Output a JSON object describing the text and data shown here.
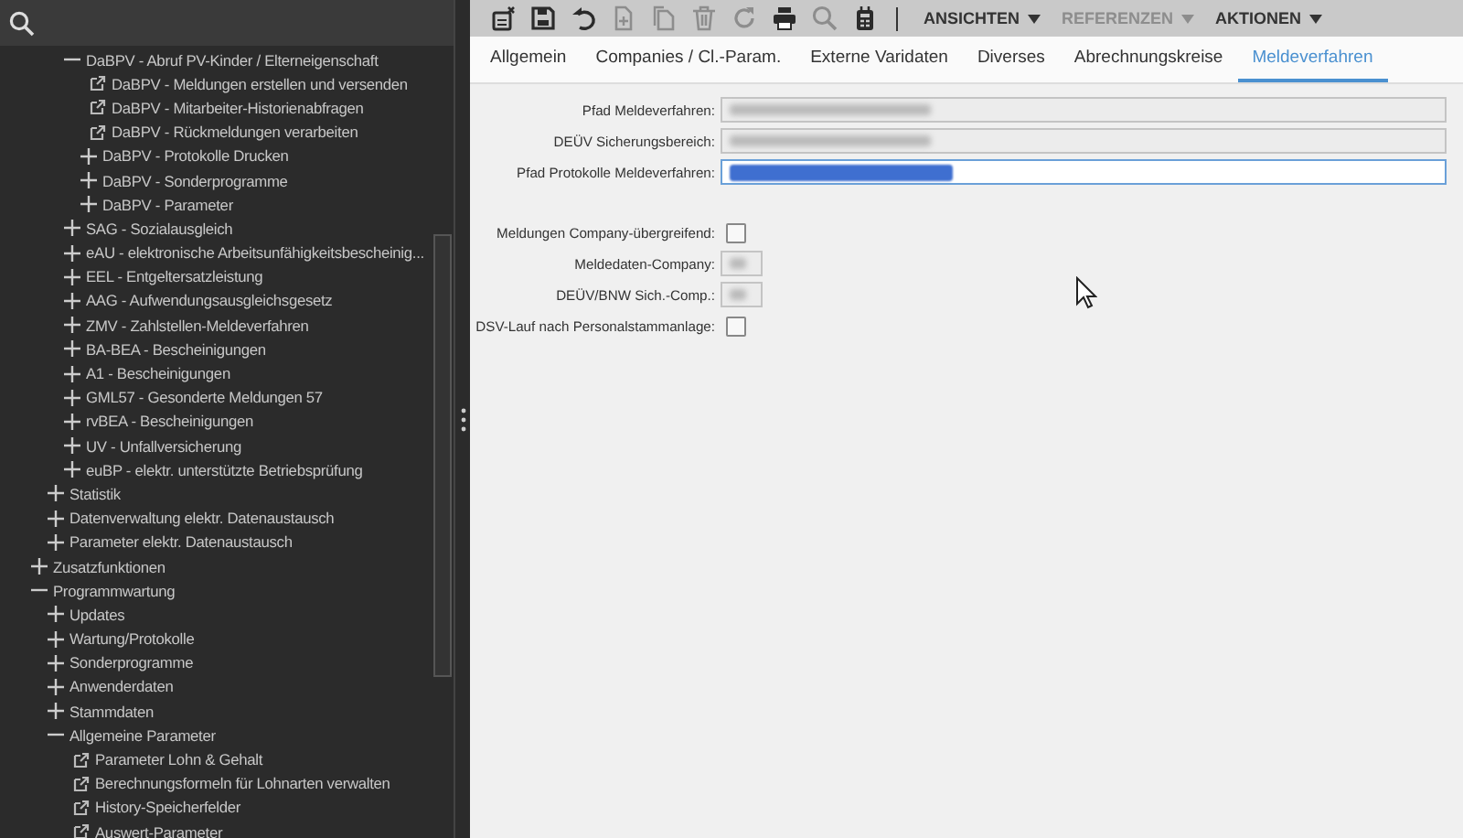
{
  "sidebar": {
    "tree": [
      {
        "children": [
          {
            "children": [
              {
                "label": "DaBPV - Abruf PV-Kinder / Elterneigenschaft",
                "expanded": true,
                "children": [
                  {
                    "label": "DaBPV - Meldungen erstellen und versenden",
                    "kind": "link"
                  },
                  {
                    "label": "DaBPV - Mitarbeiter-Historienabfragen",
                    "kind": "link"
                  },
                  {
                    "label": "DaBPV - Rückmeldungen verarbeiten",
                    "kind": "link"
                  },
                  {
                    "label": "DaBPV - Protokolle Drucken",
                    "expanded": false
                  },
                  {
                    "label": "DaBPV - Sonderprogramme",
                    "expanded": false
                  },
                  {
                    "label": "DaBPV - Parameter",
                    "expanded": false
                  }
                ]
              },
              {
                "label": "SAG - Sozialausgleich",
                "expanded": false
              },
              {
                "label": "eAU - elektronische Arbeitsunfähigkeitsbescheinig...",
                "expanded": false
              },
              {
                "label": "EEL - Entgeltersatzleistung",
                "expanded": false
              },
              {
                "label": "AAG - Aufwendungsausgleichsgesetz",
                "expanded": false
              },
              {
                "label": "ZMV - Zahlstellen-Meldeverfahren",
                "expanded": false
              },
              {
                "label": "BA-BEA - Bescheinigungen",
                "expanded": false
              },
              {
                "label": "A1 - Bescheinigungen",
                "expanded": false
              },
              {
                "label": "GML57 - Gesonderte Meldungen 57",
                "expanded": false
              },
              {
                "label": "rvBEA - Bescheinigungen",
                "expanded": false
              },
              {
                "label": "UV - Unfallversicherung",
                "expanded": false
              },
              {
                "label": "euBP - elektr. unterstützte Betriebsprüfung",
                "expanded": false
              }
            ]
          },
          {
            "label": "Statistik",
            "expanded": false
          },
          {
            "label": "Datenverwaltung elektr. Datenaustausch",
            "expanded": false
          },
          {
            "label": "Parameter elektr. Datenaustausch",
            "expanded": false
          }
        ]
      },
      {
        "label": "Zusatzfunktionen",
        "expanded": false
      },
      {
        "label": "Programmwartung",
        "expanded": true,
        "children": [
          {
            "label": "Updates",
            "expanded": false
          },
          {
            "label": "Wartung/Protokolle",
            "expanded": false
          },
          {
            "label": "Sonderprogramme",
            "expanded": false
          },
          {
            "label": "Anwenderdaten",
            "expanded": false
          },
          {
            "label": "Stammdaten",
            "expanded": false
          },
          {
            "label": "Allgemeine Parameter",
            "expanded": true,
            "children": [
              {
                "label": "Parameter Lohn & Gehalt",
                "kind": "link"
              },
              {
                "label": "Berechnungsformeln für Lohnarten verwalten",
                "kind": "link"
              },
              {
                "label": "History-Speicherfelder",
                "kind": "link"
              },
              {
                "label": "Auswert-Parameter",
                "kind": "link"
              }
            ]
          }
        ]
      }
    ]
  },
  "toolbar": {
    "buttons": [
      {
        "kind": "close-doc",
        "disabled": false
      },
      {
        "kind": "save",
        "disabled": false
      },
      {
        "kind": "undo",
        "disabled": false
      },
      {
        "kind": "new",
        "disabled": true
      },
      {
        "kind": "copy",
        "disabled": true
      },
      {
        "kind": "delete",
        "disabled": true
      },
      {
        "kind": "refresh",
        "disabled": true
      },
      {
        "kind": "print",
        "disabled": false
      },
      {
        "kind": "search",
        "disabled": true
      },
      {
        "kind": "calc",
        "disabled": false
      }
    ],
    "menus": [
      {
        "label": "ANSICHTEN",
        "disabled": false
      },
      {
        "label": "REFERENZEN",
        "disabled": true
      },
      {
        "label": "AKTIONEN",
        "disabled": false
      }
    ]
  },
  "tabs": [
    {
      "label": "Allgemein",
      "selected": false
    },
    {
      "label": "Companies / Cl.-Param.",
      "selected": false
    },
    {
      "label": "Externe Varidaten",
      "selected": false
    },
    {
      "label": "Diverses",
      "selected": false
    },
    {
      "label": "Abrechnungskreise",
      "selected": false
    },
    {
      "label": "Meldeverfahren",
      "selected": true
    }
  ],
  "form": [
    {
      "kind": "text",
      "label": "Pfad Meldeverfahren:",
      "redacted": true,
      "highlighted": false
    },
    {
      "kind": "text",
      "label": "DEÜV Sicherungsbereich:",
      "redacted": true,
      "highlighted": false
    },
    {
      "kind": "text",
      "label": "Pfad Protokolle Meldeverfahren:",
      "redacted": true,
      "highlighted": true
    },
    {
      "kind": "gap"
    },
    {
      "kind": "checkbox",
      "label": "Meldungen Company-übergreifend:",
      "checked": false
    },
    {
      "kind": "short",
      "label": "Meldedaten-Company:",
      "redacted": true
    },
    {
      "kind": "short",
      "label": "DEÜV/BNW Sich.-Comp.:",
      "redacted": true
    },
    {
      "kind": "checkbox",
      "label": "DSV-Lauf nach Personalstammanlage:",
      "checked": false
    }
  ]
}
